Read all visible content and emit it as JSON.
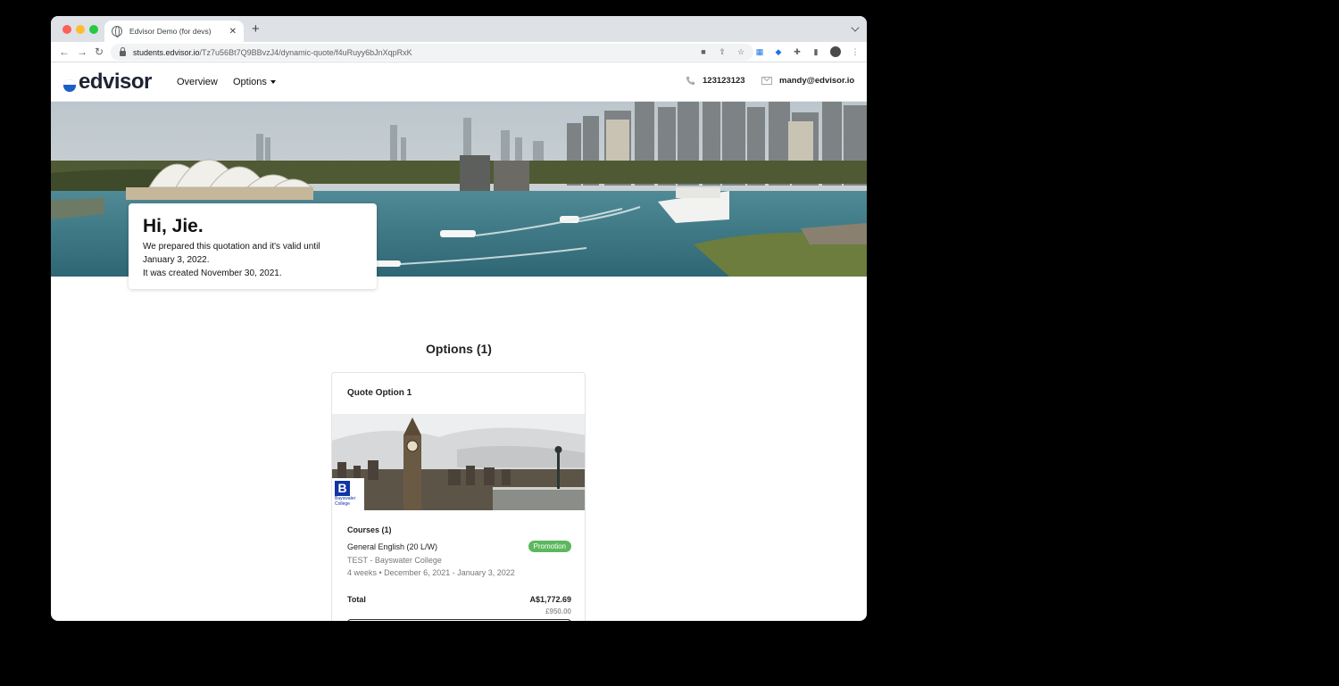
{
  "browser": {
    "tab_title": "Edvisor Demo (for devs)",
    "tab_close": "✕",
    "new_tab": "+",
    "url_host": "students.edvisor.io",
    "url_path": "/Tz7u56Bt7Q9BBvzJ4/dynamic-quote/f4uRuyy6bJnXqpRxK"
  },
  "header": {
    "logo_text": "edvisor",
    "nav": {
      "overview": "Overview",
      "options": "Options"
    },
    "phone": "123123123",
    "email": "mandy@edvisor.io"
  },
  "greeting": {
    "title": "Hi, Jie.",
    "valid_line_1": "We prepared this quotation and it's valid until",
    "valid_line_2": "January 3, 2022.",
    "created_line": "It was created November 30, 2021."
  },
  "options": {
    "heading": "Options (1)",
    "quote": {
      "title": "Quote Option 1",
      "school_logo_letter": "B",
      "school_logo_name": "Bayswater",
      "school_logo_sub": "College",
      "courses_heading": "Courses (1)",
      "course_name": "General English (20 L/W)",
      "promotion_badge": "Promotion",
      "school": "TEST - Bayswater College",
      "dates": "4 weeks • December 6, 2021 - January 3, 2022",
      "total_label": "Total",
      "total_value": "A$1,772.69",
      "total_secondary": "£950.00"
    }
  },
  "colors": {
    "brand_blue": "#1a5fc7",
    "promotion_green": "#5cb85c"
  }
}
